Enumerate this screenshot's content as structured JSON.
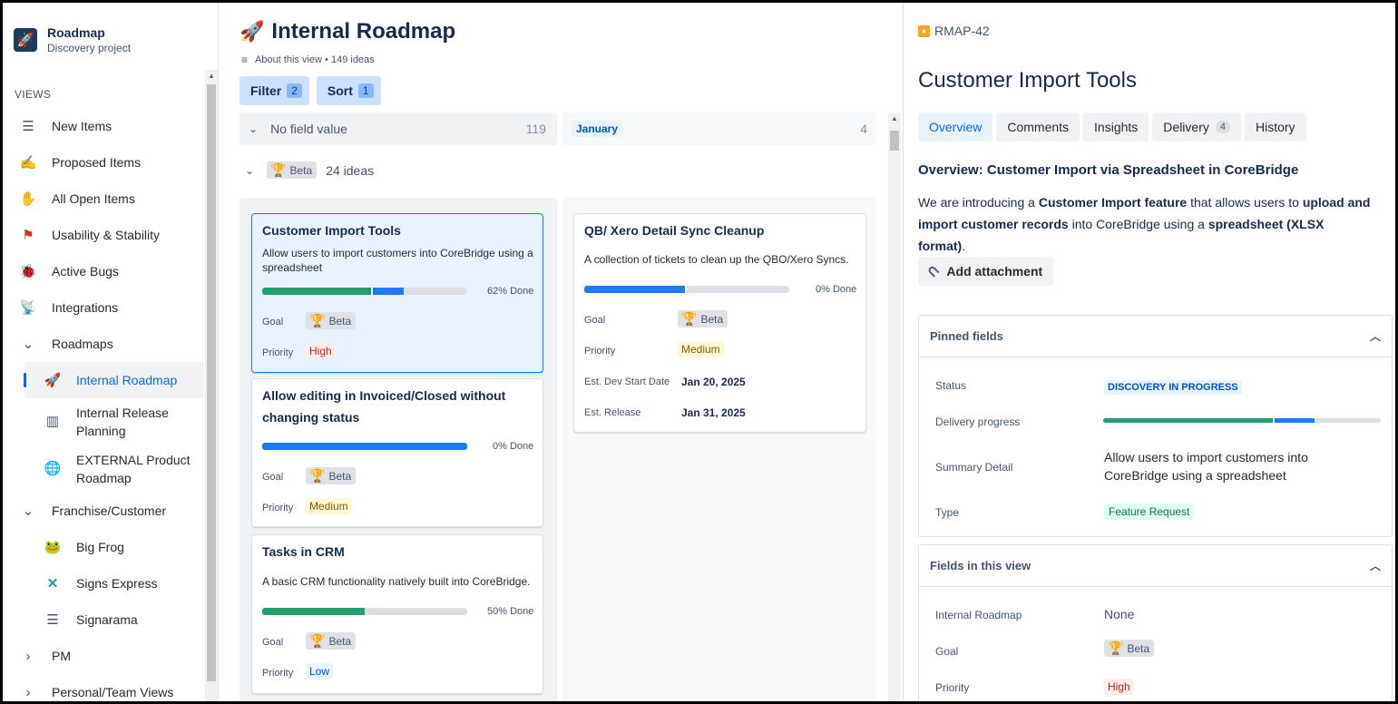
{
  "sidebar": {
    "project_name": "Roadmap",
    "project_sub": "Discovery project",
    "views_label": "VIEWS",
    "items": [
      {
        "label": "New Items"
      },
      {
        "label": "Proposed Items"
      },
      {
        "label": "All Open Items"
      },
      {
        "label": "Usability & Stability"
      },
      {
        "label": "Active Bugs"
      },
      {
        "label": "Integrations"
      },
      {
        "label": "Roadmaps"
      },
      {
        "label": "Internal Roadmap"
      },
      {
        "label": "Internal Release Planning"
      },
      {
        "label": "EXTERNAL Product Roadmap"
      },
      {
        "label": "Franchise/Customer"
      },
      {
        "label": "Big Frog"
      },
      {
        "label": "Signs Express"
      },
      {
        "label": "Signarama"
      },
      {
        "label": "PM"
      },
      {
        "label": "Personal/Team Views"
      }
    ]
  },
  "main": {
    "title": "Internal Roadmap",
    "about": "About this view • 149 ideas",
    "filter_label": "Filter",
    "filter_count": "2",
    "sort_label": "Sort",
    "sort_count": "1",
    "group_no_value": {
      "label": "No field value",
      "count": "119"
    },
    "group_january": {
      "label": "January",
      "count": "4"
    },
    "beta_group": {
      "chip": "Beta",
      "count": "24 ideas"
    },
    "cards": [
      {
        "title": "Customer Import Tools",
        "desc": "Allow users to import customers into CoreBridge using a spreadsheet",
        "progress_done": 0.62,
        "progress_green": 0.53,
        "progress_blue": 0.16,
        "pct": "62% Done",
        "goal_label": "Goal",
        "goal": "Beta",
        "priority_label": "Priority",
        "priority": "High"
      },
      {
        "title": "Allow editing in Invoiced/Closed without changing status",
        "desc": "",
        "progress_done": 0,
        "progress_green": 0,
        "progress_blue": 1.0,
        "pct": "0% Done",
        "goal_label": "Goal",
        "goal": "Beta",
        "priority_label": "Priority",
        "priority": "Medium"
      },
      {
        "title": "Tasks in CRM",
        "desc": "A basic CRM functionality natively built into CoreBridge.",
        "progress_done": 0.5,
        "progress_green": 0.5,
        "progress_blue": 0,
        "pct": "50% Done",
        "goal_label": "Goal",
        "goal": "Beta",
        "priority_label": "Priority",
        "priority": "Low"
      },
      {
        "title": "QB/ Xero Detail Sync Cleanup",
        "desc": "A collection of tickets to clean up the QBO/Xero Syncs.",
        "progress_done": 0,
        "progress_green": 0,
        "progress_blue": 0.5,
        "pct": "0% Done",
        "goal_label": "Goal",
        "goal": "Beta",
        "priority_label": "Priority",
        "priority": "Medium",
        "start_label": "Est. Dev Start Date",
        "start": "Jan 20, 2025",
        "release_label": "Est. Release",
        "release": "Jan 31, 2025"
      }
    ]
  },
  "detail": {
    "key": "RMAP-42",
    "title": "Customer Import Tools",
    "tabs": [
      {
        "label": "Overview"
      },
      {
        "label": "Comments"
      },
      {
        "label": "Insights"
      },
      {
        "label": "Delivery",
        "count": "4"
      },
      {
        "label": "History"
      }
    ],
    "overview_heading": "Overview: Customer Import via Spreadsheet in CoreBridge",
    "overview_parts": [
      "We are introducing a ",
      "Customer Import feature",
      " that allows users to ",
      "upload and import customer records",
      " into CoreBridge using a ",
      "spreadsheet (XLSX format)",
      "."
    ],
    "attach_label": "Add attachment",
    "pinned": {
      "header": "Pinned fields",
      "status_label": "Status",
      "status": "DISCOVERY IN PROGRESS",
      "delivery_label": "Delivery progress",
      "delivery_green": 0.61,
      "delivery_blue": 0.15,
      "summary_label": "Summary Detail",
      "summary": "Allow users to import customers into CoreBridge using a spreadsheet",
      "type_label": "Type",
      "type": "Feature Request"
    },
    "fields": {
      "header": "Fields in this view",
      "roadmap_label": "Internal Roadmap",
      "roadmap": "None",
      "goal_label": "Goal",
      "goal": "Beta",
      "priority_label": "Priority",
      "priority": "High"
    }
  }
}
